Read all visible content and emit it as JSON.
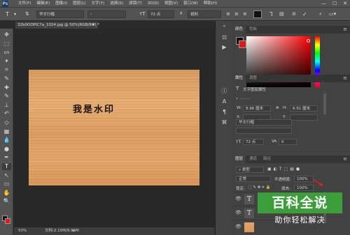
{
  "app": {
    "logo": "Ps"
  },
  "menu": [
    "文件(F)",
    "编辑(E)",
    "图像(I)",
    "图层(L)",
    "文字(Y)",
    "选择(S)",
    "滤镜(T)",
    "3D(D)",
    "视图(V)",
    "窗口(W)",
    "帮助(H)"
  ],
  "window_controls": [
    "—",
    "☐",
    "✕"
  ],
  "options": {
    "tool_icon": "T",
    "font_family": "华文行楷",
    "font_style": "-",
    "font_size": "72 点",
    "antialias": "锐利"
  },
  "document": {
    "tab_title": "32b0OOPIC7a_1024.jpg @ 50%(RGB/8#) *",
    "close": "×",
    "watermark_text": "我是水印"
  },
  "status": {
    "zoom": "50%",
    "doc_info": "文档:2.15M/9.93M"
  },
  "tools": [
    "move-icon",
    "marquee-icon",
    "lasso-icon",
    "magic-wand-icon",
    "crop-icon",
    "eyedropper-icon",
    "healing-icon",
    "brush-icon",
    "stamp-icon",
    "history-brush-icon",
    "eraser-icon",
    "gradient-icon",
    "blur-icon",
    "dodge-icon",
    "pen-icon",
    "type-icon",
    "path-select-icon",
    "rectangle-icon",
    "hand-icon",
    "zoom-icon"
  ],
  "tool_glyphs": [
    "✥",
    "⬚",
    "ᔕ",
    "✦",
    "⌗",
    "✎",
    "✚",
    "✎",
    "⊥",
    "↶",
    "◇",
    "▦",
    "💧",
    "●",
    "✒",
    "T",
    "↖",
    "▭",
    "✋",
    "🔍"
  ],
  "panels": {
    "color": {
      "tabs": [
        "颜色",
        "色板"
      ],
      "fg": "#111111",
      "bg": "#e01818"
    },
    "properties": {
      "tabs": [
        "属性",
        "调整"
      ],
      "section": "文字图层属性",
      "w_label": "W:",
      "w_value": "8.96 厘米",
      "h_label": "H:",
      "h_value": "6.91 厘米",
      "x_label": "X:",
      "x_value": "",
      "y_label": "Y:",
      "y_value": "",
      "font": "华文行楷",
      "size": "72 点",
      "tracking": "0"
    },
    "layers": {
      "tabs": [
        "图层",
        "通道",
        "路径"
      ],
      "filter": "类型",
      "blend": "正常",
      "opacity_label": "不透明度:",
      "opacity": "100%",
      "lock_label": "锁定:",
      "fill_label": "填充:",
      "fill": "100%",
      "rows": [
        {
          "thumb": "T"
        },
        {
          "thumb": "T"
        }
      ]
    }
  },
  "brand": {
    "title": "百科全说",
    "subtitle": "助你轻松解决"
  }
}
